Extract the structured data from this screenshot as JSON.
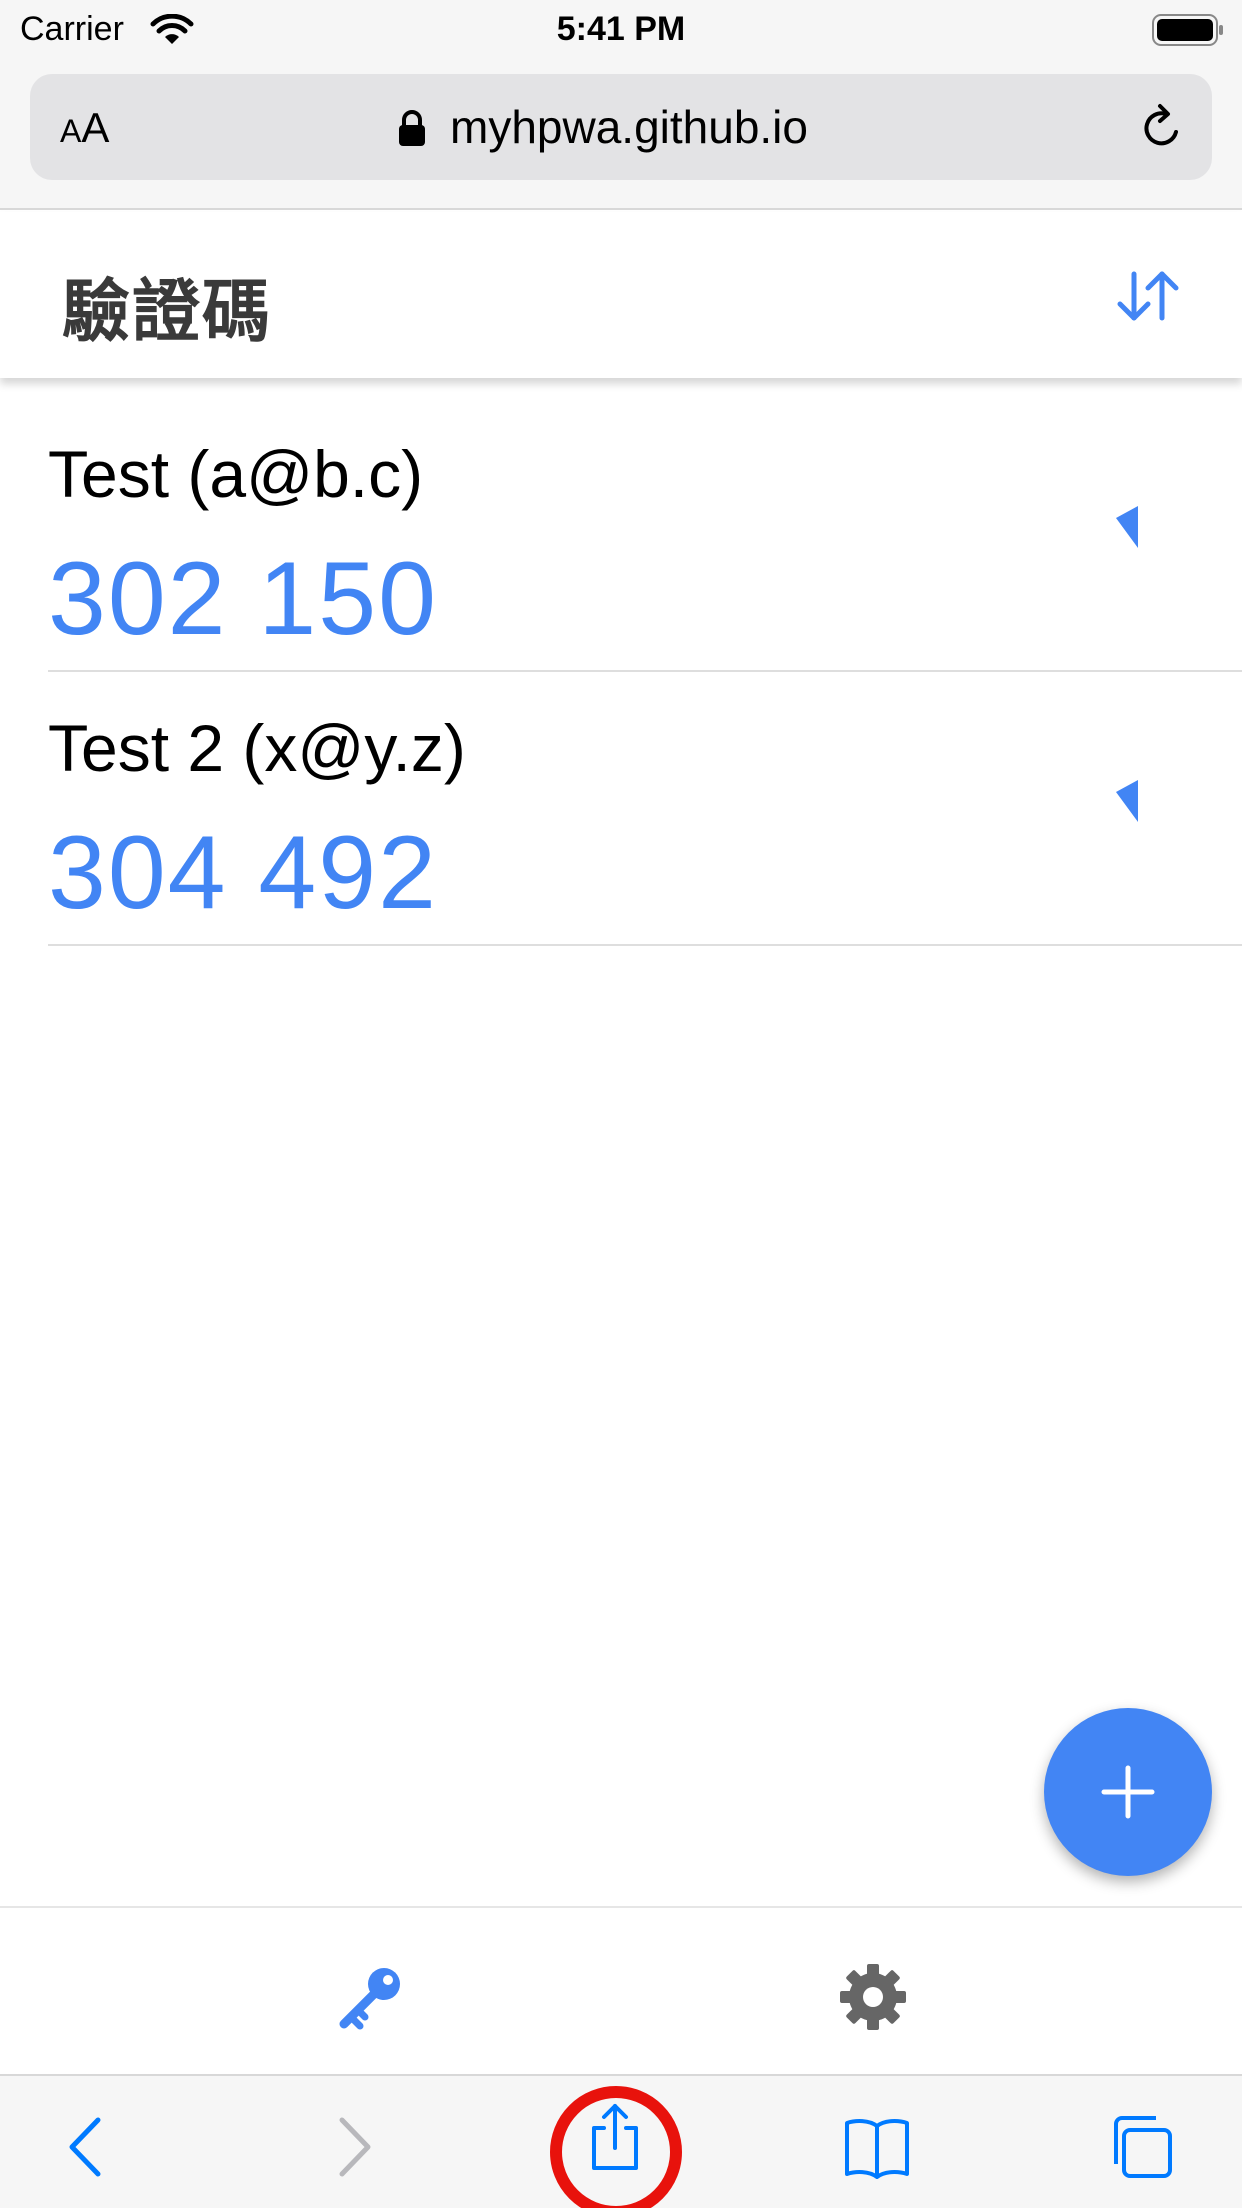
{
  "status_bar": {
    "carrier": "Carrier",
    "time": "5:41 PM"
  },
  "browser": {
    "text_size_small": "A",
    "text_size_large": "A",
    "url": "myhpwa.github.io"
  },
  "app": {
    "title": "驗證碼",
    "accent_color": "#4285f4",
    "accounts": [
      {
        "name": "Test (a@b.c)",
        "code": "302 150"
      },
      {
        "name": "Test 2 (x@y.z)",
        "code": "304 492"
      }
    ],
    "nav": [
      "key-icon",
      "gear-icon"
    ]
  },
  "safari_toolbar": {
    "items": [
      "back-icon",
      "forward-icon",
      "share-icon",
      "bookmarks-icon",
      "tabs-icon"
    ],
    "highlight_color": "#e8120c"
  }
}
